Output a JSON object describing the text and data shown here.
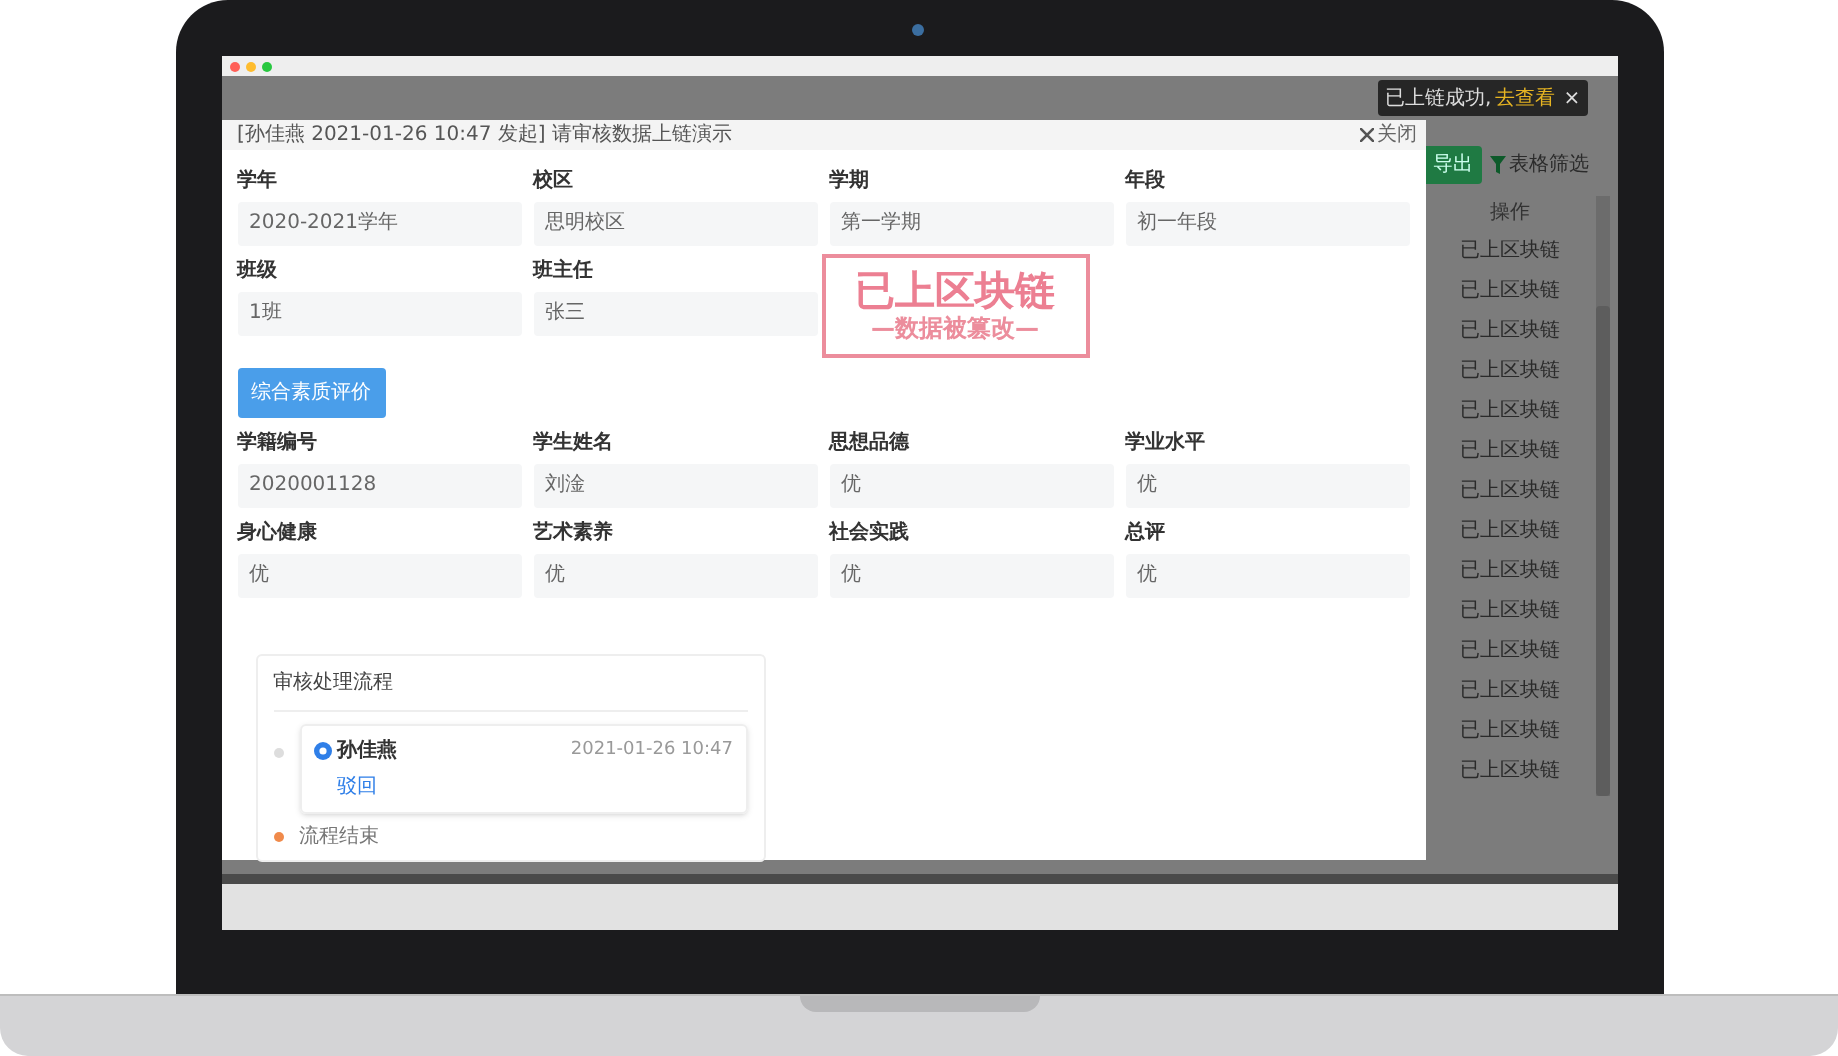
{
  "modal": {
    "title": "[孙佳燕 2021-01-26 10:47 发起] 请审核数据上链演示",
    "close_label": "关闭",
    "basic_fields": [
      {
        "label": "学年",
        "value": "2020-2021学年"
      },
      {
        "label": "校区",
        "value": "思明校区"
      },
      {
        "label": "学期",
        "value": "第一学期"
      },
      {
        "label": "年段",
        "value": "初一年段"
      },
      {
        "label": "班级",
        "value": "1班"
      },
      {
        "label": "班主任",
        "value": "张三"
      }
    ],
    "section_button": "综合素质评价",
    "evaluation_fields": [
      {
        "label": "学籍编号",
        "value": "2020001128"
      },
      {
        "label": "学生姓名",
        "value": "刘淦"
      },
      {
        "label": "思想品德",
        "value": "优"
      },
      {
        "label": "学业水平",
        "value": "优"
      },
      {
        "label": "身心健康",
        "value": "优"
      },
      {
        "label": "艺术素养",
        "value": "优"
      },
      {
        "label": "社会实践",
        "value": "优"
      },
      {
        "label": "总评",
        "value": "优"
      }
    ],
    "process": {
      "title": "审核处理流程",
      "steps": [
        {
          "kind": "task",
          "name": "孙佳燕",
          "time": "2021-01-26 10:47",
          "action": "驳回"
        },
        {
          "kind": "end",
          "name": "流程结束"
        }
      ]
    },
    "stamp": {
      "title": "已上区块链",
      "subtitle": "—数据被篡改—"
    }
  },
  "background": {
    "toast": {
      "text": "已上链成功,",
      "link": "去查看",
      "close": "×"
    },
    "export_button": "导出",
    "filter_label": "表格筛选",
    "column_header": "操作",
    "rows": [
      {
        "status": "已上区块链"
      },
      {
        "status": "已上区块链"
      },
      {
        "status": "已上区块链"
      },
      {
        "status": "已上区块链"
      },
      {
        "status": "已上区块链"
      },
      {
        "status": "已上区块链"
      },
      {
        "status": "已上区块链"
      },
      {
        "status": "已上区块链"
      },
      {
        "status": "已上区块链"
      },
      {
        "status": "已上区块链"
      },
      {
        "status": "已上区块链"
      },
      {
        "status": "已上区块链"
      },
      {
        "status": "已上区块链"
      },
      {
        "status": "已上区块链"
      }
    ]
  }
}
